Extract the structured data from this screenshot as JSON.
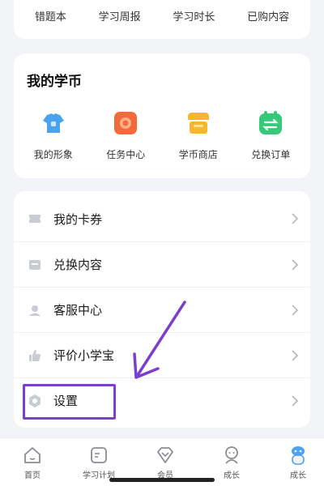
{
  "top_links": [
    "错题本",
    "学习周报",
    "学习时长",
    "已购内容"
  ],
  "coins": {
    "title": "我的学币",
    "items": [
      {
        "label": "我的形象",
        "icon": "avatar-icon",
        "color": "#4aa3f0"
      },
      {
        "label": "任务中心",
        "icon": "task-icon",
        "color": "#f26a3a"
      },
      {
        "label": "学币商店",
        "icon": "shop-icon",
        "color": "#f5b731"
      },
      {
        "label": "兑换订单",
        "icon": "exchange-icon",
        "color": "#37c978"
      }
    ]
  },
  "menu": [
    {
      "label": "我的卡券",
      "icon": "ticket-icon"
    },
    {
      "label": "兑换内容",
      "icon": "redeem-icon"
    },
    {
      "label": "客服中心",
      "icon": "headset-icon"
    },
    {
      "label": "评价小学宝",
      "icon": "thumbs-up-icon"
    },
    {
      "label": "设置",
      "icon": "gear-icon"
    }
  ],
  "nav": [
    {
      "label": "首页",
      "icon": "home-icon"
    },
    {
      "label": "学习计划",
      "icon": "plan-icon"
    },
    {
      "label": "会员",
      "icon": "vip-icon"
    },
    {
      "label": "成长",
      "icon": "growth-icon"
    },
    {
      "label": "成长",
      "icon": "mascot-icon"
    }
  ],
  "colors": {
    "highlight": "#7b3fd0",
    "accent": "#4aa3f0"
  }
}
